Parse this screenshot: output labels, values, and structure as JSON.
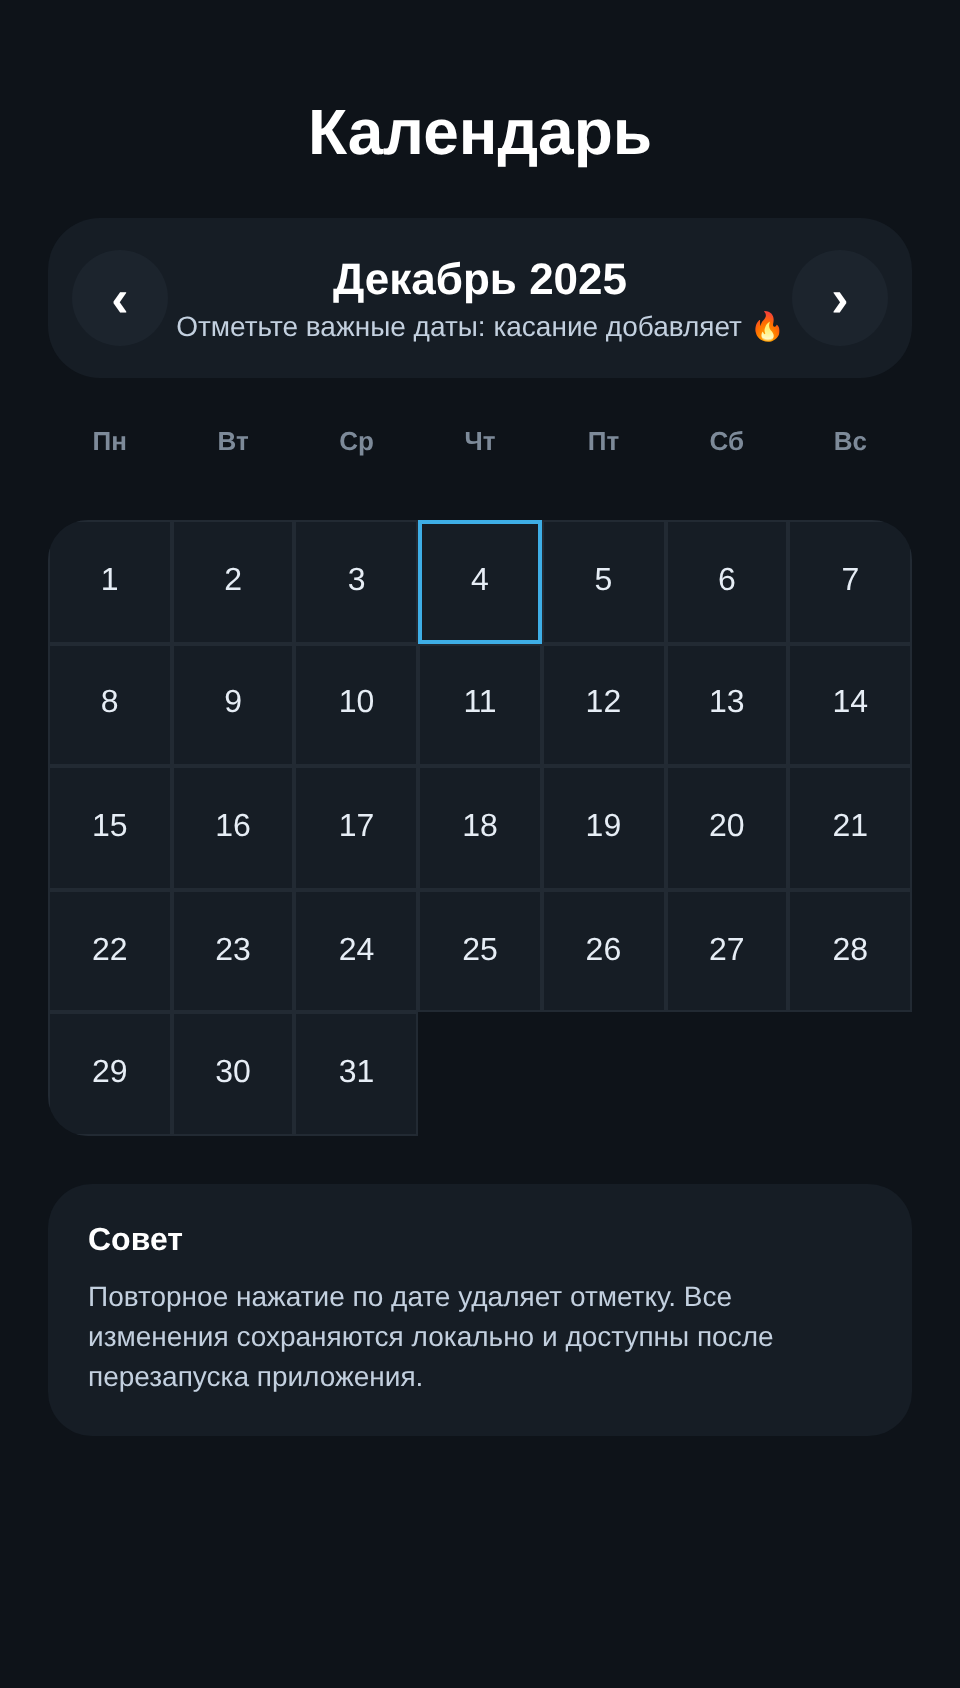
{
  "title": "Календарь",
  "header": {
    "prev": "‹",
    "month": "Декабрь 2025",
    "hint": "Отметьте важные даты: касание добавляет 🔥",
    "next": "›"
  },
  "weekdays": [
    "Пн",
    "Вт",
    "Ср",
    "Чт",
    "Пт",
    "Сб",
    "Вс"
  ],
  "days": [
    {
      "label": "1",
      "selected": false
    },
    {
      "label": "2",
      "selected": false
    },
    {
      "label": "3",
      "selected": false
    },
    {
      "label": "4",
      "selected": true
    },
    {
      "label": "5",
      "selected": false
    },
    {
      "label": "6",
      "selected": false
    },
    {
      "label": "7",
      "selected": false
    },
    {
      "label": "8",
      "selected": false
    },
    {
      "label": "9",
      "selected": false
    },
    {
      "label": "10",
      "selected": false
    },
    {
      "label": "11",
      "selected": false
    },
    {
      "label": "12",
      "selected": false
    },
    {
      "label": "13",
      "selected": false
    },
    {
      "label": "14",
      "selected": false
    },
    {
      "label": "15",
      "selected": false
    },
    {
      "label": "16",
      "selected": false
    },
    {
      "label": "17",
      "selected": false
    },
    {
      "label": "18",
      "selected": false
    },
    {
      "label": "19",
      "selected": false
    },
    {
      "label": "20",
      "selected": false
    },
    {
      "label": "21",
      "selected": false
    },
    {
      "label": "22",
      "selected": false
    },
    {
      "label": "23",
      "selected": false
    },
    {
      "label": "24",
      "selected": false
    },
    {
      "label": "25",
      "selected": false
    },
    {
      "label": "26",
      "selected": false
    },
    {
      "label": "27",
      "selected": false
    },
    {
      "label": "28",
      "selected": false
    },
    {
      "label": "29",
      "selected": false
    },
    {
      "label": "30",
      "selected": false
    },
    {
      "label": "31",
      "selected": false
    }
  ],
  "tip": {
    "title": "Совет",
    "text": "Повторное нажатие по дате удаляет отметку. Все изменения сохраняются локально и доступны после перезапуска приложения."
  }
}
